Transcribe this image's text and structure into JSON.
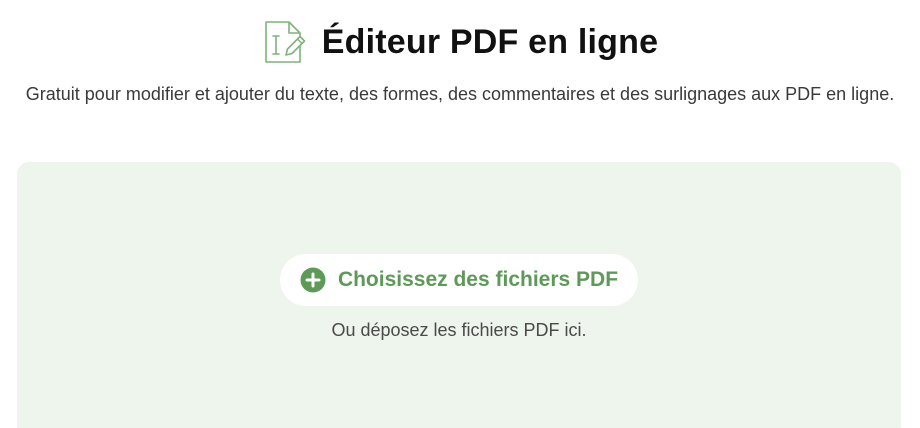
{
  "header": {
    "title": "Éditeur PDF en ligne",
    "icon": "pdf-edit-icon",
    "subtitle": "Gratuit pour modifier et ajouter du texte, des formes, des commentaires et des surlignages aux PDF en ligne."
  },
  "dropzone": {
    "choose_button_label": "Choisissez des fichiers PDF",
    "choose_button_icon": "plus-circle-icon",
    "drop_hint": "Ou déposez les fichiers PDF ici."
  },
  "colors": {
    "accent": "#5d9a58",
    "dropzone_bg": "#eef5ec",
    "icon_stroke": "#7fb37a"
  }
}
